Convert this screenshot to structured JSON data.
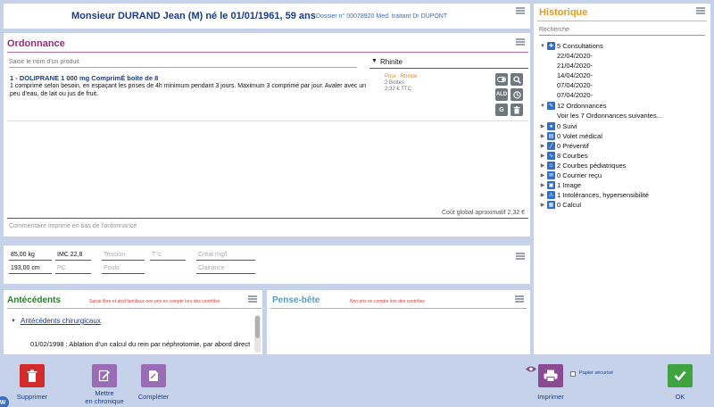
{
  "header": {
    "patient": "Monsieur DURAND Jean (M) né le 01/01/1961, 59 ans",
    "dossier": "Dossier n° 00078920 Med. traitant Dr DUPONT"
  },
  "ordonnance": {
    "title": "Ordonnance",
    "product_placeholder": "Saisir le nom d'un produit",
    "diagnosis": "Rhinite",
    "medication": {
      "name": "1 - DOLIPRANE 1 000 mg ComprimÉ boîte de 8",
      "posology": "1 comprimé selon besoin, en espaçant les prises de 4h minimum pendant 3 jours. Maximum 3 comprimé par jour. Avaler avec un peu d'eau, de lait ou jus de fruit.",
      "pour": "Pour : Rhinite",
      "boites": "2 Boîtes",
      "prix": "2,32 € TTC"
    },
    "buttons": {
      "ald": "ALD",
      "g": "G"
    },
    "cout_global": "Coût global aproximatif  2,32 €",
    "comment_placeholder": "Commentaire imprimé en bas de l'ordonnance"
  },
  "vitals": {
    "poids": "85,00 kg",
    "taille": "193,00 cm",
    "imc": "IMC 22,8",
    "pc": "PC",
    "tension": "Tension",
    "pouls": "Pouls",
    "temp": "T°c",
    "creat": "Créat mg/l",
    "clairance": "Clairance"
  },
  "antecedents": {
    "title": "Antécédents",
    "note": "Saisie libre et atcd familiaux non pris en compte lors des contrôles",
    "category": "Antécédents chirurgicaux",
    "entry": "01/02/1998 : Ablation d'un calcul du rein par néphrotomie, par abord direct"
  },
  "pense_bete": {
    "title": "Pense-bête",
    "note": "Non pris en compte lors des contrôles"
  },
  "historique": {
    "title": "Historique",
    "search_placeholder": "Recherche",
    "consultations": {
      "label": "5 Consultations",
      "dates": [
        "22/04/2020-",
        "21/04/2020-",
        "14/04/2020-",
        "07/04/2020-",
        "07/04/2020-"
      ]
    },
    "ordonnances": {
      "label": "12 Ordonnances",
      "more": "Voir les 7 Ordonnances suivantes..."
    },
    "items": [
      "0 Suivi",
      "0 Volet médical",
      "0 Préventif",
      "8 Courbes",
      "2 Courbes pédiatriques",
      "0 Courrier reçu",
      "1 Image",
      "1 Intolérances, hypersensibilité",
      "0 Calcul"
    ]
  },
  "bottom": {
    "supprimer": "Supprimer",
    "chronique_1": "Mettre",
    "chronique_2": "en chronique",
    "completer": "Compléter",
    "imprimer": "Imprimer",
    "papier": "Papier sécurisé",
    "ok": "OK"
  },
  "colors": {
    "supprimer": "#d12b2b",
    "chronique": "#9a6cb5",
    "imprimer": "#8c4a94",
    "ok": "#3fa33f",
    "ordonnance_title": "#9b2a7d",
    "historique_title": "#e69a1e",
    "antecedents_title": "#2e7d32",
    "pense_bete_title": "#5a9cc0"
  }
}
